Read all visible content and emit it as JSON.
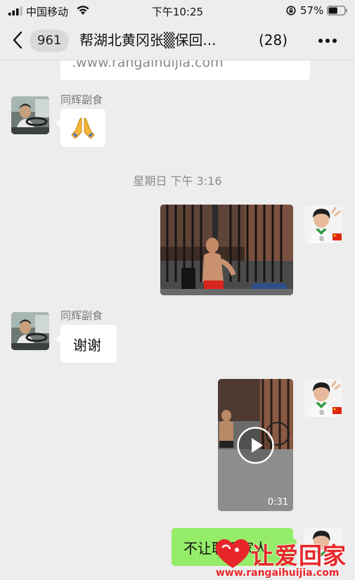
{
  "status_bar": {
    "carrier": "中国移动",
    "time": "下午10:25",
    "battery_percent": "57%",
    "battery_level": 0.57
  },
  "nav": {
    "unread_count": "961",
    "title": "帮湖北黄冈张▒保回...",
    "member_count": "(28)"
  },
  "messages": {
    "link_partial": ".www.rangaihuijia.com",
    "sender_1": "同辉副食",
    "emoji_message": "pray-icon",
    "timestamp": "星期日 下午 3:16",
    "sender_2": "同辉副食",
    "text_1": "谢谢",
    "video_duration": "0:31",
    "text_2": "不让联系家人"
  },
  "watermark": {
    "title": "让爱回家",
    "url": "www.rangaihuijia.com"
  },
  "colors": {
    "background": "#ededed",
    "own_bubble": "#95ec69",
    "other_bubble": "#ffffff",
    "watermark_red": "#e8262a"
  }
}
